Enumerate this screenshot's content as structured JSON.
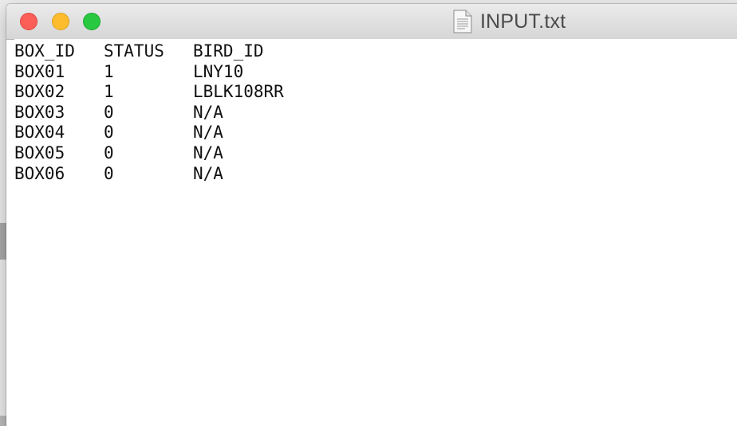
{
  "window": {
    "title": "INPUT.txt",
    "icon": "text-document-icon"
  },
  "file": {
    "header": [
      "BOX_ID",
      "STATUS",
      "BIRD_ID"
    ],
    "rows": [
      [
        "BOX01",
        "1",
        "LNY10"
      ],
      [
        "BOX02",
        "1",
        "LBLK108RR"
      ],
      [
        "BOX03",
        "0",
        "N/A"
      ],
      [
        "BOX04",
        "0",
        "N/A"
      ],
      [
        "BOX05",
        "0",
        "N/A"
      ],
      [
        "BOX06",
        "0",
        "N/A"
      ]
    ]
  },
  "colors": {
    "close": "#fc5f57",
    "minimize": "#fdbc2e",
    "zoom": "#28c840"
  }
}
